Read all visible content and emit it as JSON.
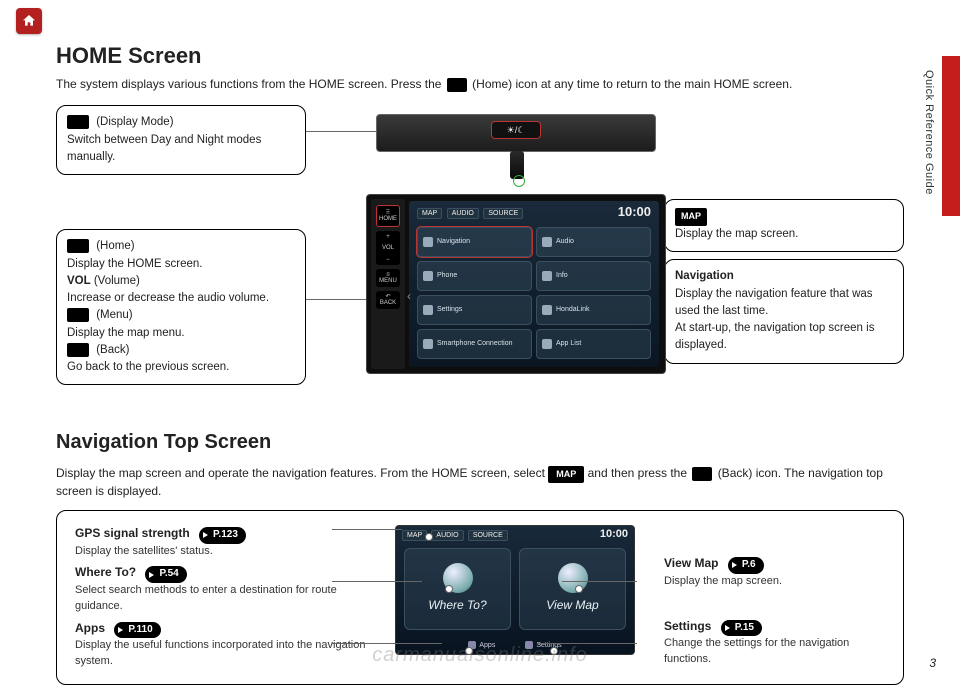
{
  "corner": {
    "name": "home"
  },
  "sideLabel": "Quick Reference Guide",
  "pageNumber": "3",
  "watermark": "carmanualsonline.info",
  "section1": {
    "title": "HOME Screen",
    "introA": "The system displays various functions from the HOME screen. Press the ",
    "introIconAlt": "HOME",
    "introB": " (Home) icon at any time to return to the main HOME screen.",
    "calloutDisplayMode": {
      "label": "(Display Mode)",
      "desc": "Switch between Day and Night modes manually."
    },
    "calloutButtons": {
      "home": {
        "label": "(Home)",
        "desc": "Display the HOME screen."
      },
      "vol": {
        "label": "VOL",
        "sub": "(Volume)",
        "desc": "Increase or decrease the audio volume."
      },
      "menu": {
        "label": "(Menu)",
        "desc": "Display the map menu."
      },
      "back": {
        "label": "(Back)",
        "desc": "Go back to the previous screen."
      }
    },
    "calloutMap": {
      "btn": "MAP",
      "desc": "Display the map screen."
    },
    "calloutNav": {
      "title": "Navigation",
      "desc1": "Display the navigation feature that was used the last time.",
      "desc2": "At start-up, the navigation top screen is displayed."
    },
    "screen": {
      "tabs": [
        "MAP",
        "AUDIO",
        "SOURCE"
      ],
      "clock": "10:00",
      "tiles": [
        "Navigation",
        "Audio",
        "Phone",
        "Info",
        "Settings",
        "HondaLink",
        "Smartphone Connection",
        "App List"
      ]
    },
    "sideButtons": [
      "HOME",
      "VOL",
      "MENU",
      "BACK"
    ]
  },
  "section2": {
    "title": "Navigation Top Screen",
    "introA": "Display the map screen and operate the navigation features. From the HOME screen, select ",
    "mapBtn": "MAP",
    "introB": " and then press the ",
    "backIconAlt": "BACK",
    "introC": " (Back) icon. The navigation top screen is displayed.",
    "left": [
      {
        "title": "GPS signal strength",
        "page": "P.123",
        "desc": "Display the satellites' status."
      },
      {
        "title": "Where To?",
        "page": "P.54",
        "desc": "Select search methods to enter a destination for route guidance."
      },
      {
        "title": "Apps",
        "page": "P.110",
        "desc": "Display the useful functions incorporated into the navigation system."
      }
    ],
    "right": [
      {
        "title": "View Map",
        "page": "P.6",
        "desc": "Display the map screen."
      },
      {
        "title": "Settings",
        "page": "P.15",
        "desc": "Change the settings for the navigation functions."
      }
    ],
    "navScreen": {
      "tabs": [
        "MAP",
        "AUDIO",
        "SOURCE"
      ],
      "clock": "10:00",
      "tiles": [
        "Where To?",
        "View Map"
      ],
      "bottom": [
        "Apps",
        "Settings"
      ]
    }
  }
}
